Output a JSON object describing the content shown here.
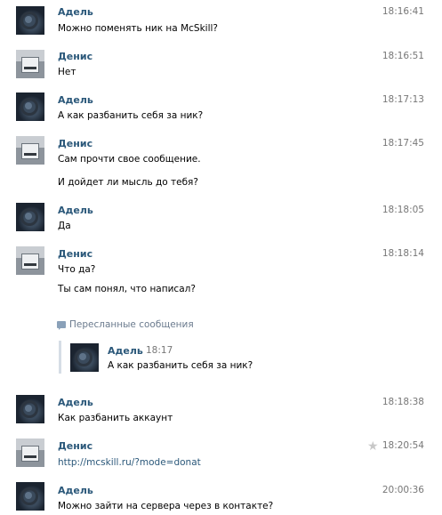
{
  "messages": [
    {
      "author": "Адель",
      "time": "18:16:41",
      "lines": [
        "Можно поменять ник на McSkill?"
      ]
    },
    {
      "author": "Денис",
      "time": "18:16:51",
      "lines": [
        "Нет"
      ]
    },
    {
      "author": "Адель",
      "time": "18:17:13",
      "lines": [
        "А как разбанить себя за ник?"
      ]
    },
    {
      "author": "Денис",
      "time": "18:17:45",
      "lines": [
        "Сам прочти свое сообщение.",
        "И дойдет ли мысль до тебя?"
      ]
    },
    {
      "author": "Адель",
      "time": "18:18:05",
      "lines": [
        "Да"
      ]
    },
    {
      "author": "Денис",
      "time": "18:18:14",
      "lines": [
        "Что да?",
        "Ты сам понял, что написал?"
      ]
    },
    {
      "author": "Адель",
      "time": "18:18:38",
      "lines": [
        "Как разбанить аккаунт"
      ]
    },
    {
      "author": "Денис",
      "time": "18:20:54",
      "lines": [
        "http://mcskill.ru/?mode=donat"
      ]
    },
    {
      "author": "Адель",
      "time": "20:00:36",
      "lines": [
        "Можно зайти на сервера через в контакте?"
      ]
    }
  ],
  "forwarded": {
    "label": "Пересланные сообщения",
    "author": "Адель",
    "time": "18:17",
    "text": "А как разбанить себя за ник?"
  },
  "icons": {
    "star": "star-icon",
    "forward": "forward-icon"
  },
  "colors": {
    "name": "#2b587a",
    "time": "#777777",
    "link": "#2b587a"
  }
}
